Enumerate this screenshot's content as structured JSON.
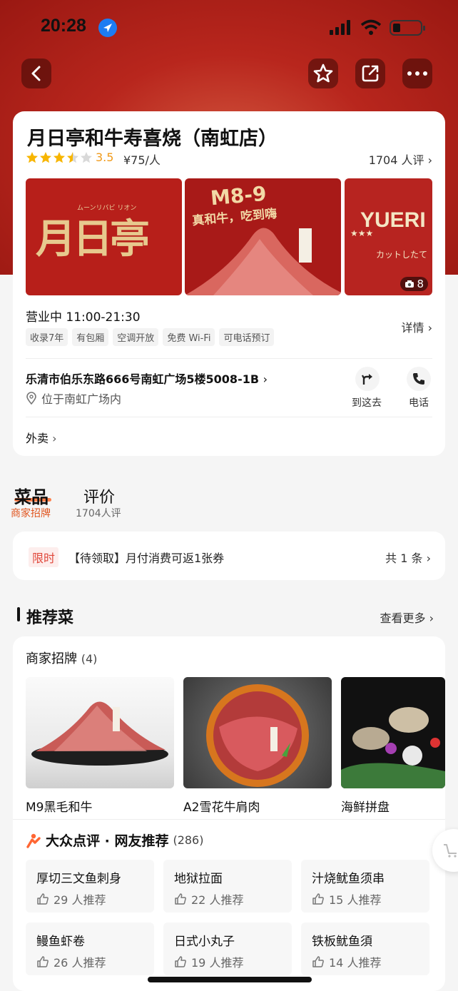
{
  "status_bar": {
    "time": "20:28"
  },
  "shop": {
    "name": "月日亭和牛寿喜烧（南虹店）",
    "rating": "3.5",
    "price": "¥75/人",
    "review_count": "1704 人评",
    "photo_count": "8",
    "photos": [
      {
        "text": "月日亭",
        "sub": "ムーンリバビ リオン"
      },
      {
        "text": "M8-9",
        "sub": "真和牛，吃到嗨"
      },
      {
        "text": "YUERI",
        "sub": "カットしたて"
      }
    ],
    "hours": "营业中 11:00-21:30",
    "tags": [
      "收录7年",
      "有包厢",
      "空调开放",
      "免费 Wi-Fi",
      "可电话预订"
    ],
    "detail_label": "详情",
    "address": "乐清市伯乐东路666号南虹广场5楼5008-1B",
    "address_sub": "位于南虹广场内",
    "nav_label": "到这去",
    "phone_label": "电话",
    "takeout_label": "外卖"
  },
  "tabs": {
    "dishes": {
      "label": "菜品",
      "sub": "商家招牌"
    },
    "reviews": {
      "label": "评价",
      "sub": "1704人评"
    }
  },
  "promo": {
    "tag": "限时",
    "text": "【待领取】月付消费可返1张券",
    "count": "共 1 条"
  },
  "recommend": {
    "title": "推荐菜",
    "more": "查看更多",
    "signature_title": "商家招牌",
    "signature_count": "(4)",
    "dishes": [
      {
        "name": "M9黑毛和牛"
      },
      {
        "name": "A2雪花牛肩肉"
      },
      {
        "name": "海鲜拼盘"
      }
    ],
    "dp_title": "大众点评 · 网友推荐",
    "dp_count": "(286)",
    "items": [
      {
        "name": "厚切三文鱼刺身",
        "count": "29 人推荐"
      },
      {
        "name": "地狱拉面",
        "count": "22 人推荐"
      },
      {
        "name": "汁烧鱿鱼须串",
        "count": "15 人推荐"
      },
      {
        "name": "鳗鱼虾卷",
        "count": "26 人推荐"
      },
      {
        "name": "日式小丸子",
        "count": "19 人推荐"
      },
      {
        "name": "铁板鱿鱼須",
        "count": "14 人推荐"
      }
    ]
  },
  "icons": {
    "back": "chevron-left-icon",
    "favorite": "star-icon",
    "share": "share-icon",
    "more": "more-dots-icon",
    "location_pin": "location-pin-icon",
    "directions": "directions-icon",
    "phone": "phone-icon",
    "thumb": "thumb-up-icon",
    "dianping": "dianping-logo-icon",
    "camera": "camera-icon",
    "cart": "cart-icon"
  },
  "colors": {
    "hero_red": "#b8261d",
    "accent_orange": "#ff6a2c",
    "star_yellow": "#f7b500",
    "promo_red": "#e0473a"
  }
}
